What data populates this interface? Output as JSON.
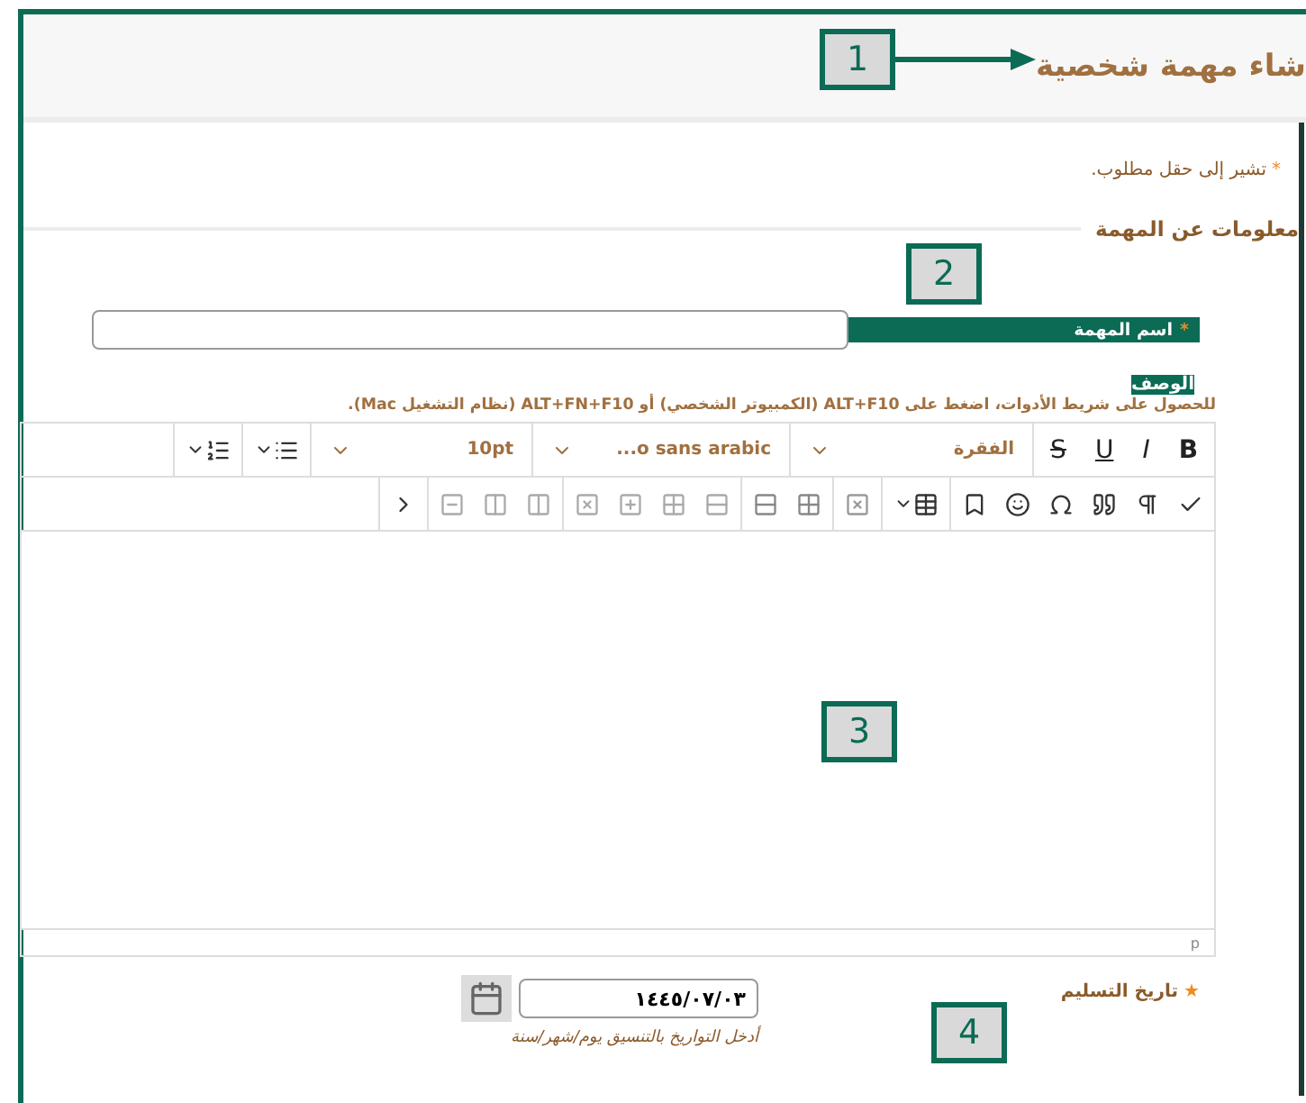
{
  "header": {
    "title": "شاء مهمة شخصية"
  },
  "required_note": {
    "mark": "*",
    "text": "تشير إلى حقل مطلوب."
  },
  "section": {
    "title": "معلومات عن المهمة"
  },
  "task_name": {
    "label": "اسم المهمة",
    "required": true,
    "required_mark": "*"
  },
  "description": {
    "label": "الوصف",
    "help": "للحصول على شريط الأدوات، اضغط على ALT+F10 (الكمبيوتر الشخصي) أو ALT+FN+F10 (نظام التشغيل Mac).",
    "format_buttons": [
      "B",
      "I",
      "U",
      "S"
    ],
    "dropdowns": [
      "الفقرة",
      "...o sans arabic",
      "10pt"
    ],
    "status_path": "p"
  },
  "due_date": {
    "label": "تاريخ التسليم",
    "required": true,
    "required_mark": "★",
    "value": "١٤٤٥/٠٧/٠٣",
    "hint": "أدخل التواريخ بالتنسيق يوم/شهر/سنة"
  },
  "callouts": [
    {
      "label": "1"
    },
    {
      "label": "2"
    },
    {
      "label": "3"
    },
    {
      "label": "4"
    }
  ]
}
